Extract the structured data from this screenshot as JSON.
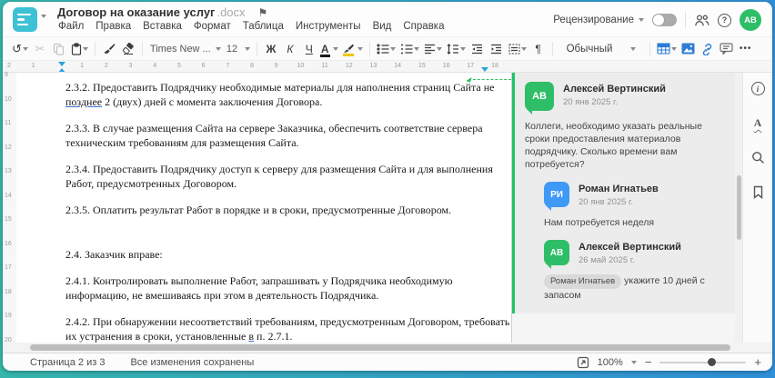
{
  "header": {
    "title": "Договор на оказание услуг",
    "title_ext": ".docx",
    "menu": [
      "Файл",
      "Правка",
      "Вставка",
      "Формат",
      "Таблица",
      "Инструменты",
      "Вид",
      "Справка"
    ],
    "review_label": "Рецензирование",
    "help_glyph": "?",
    "avatar_initials": "АВ"
  },
  "toolbar": {
    "undo_glyph": "↺",
    "cut_glyph": "✂",
    "font_name": "Times New ...",
    "font_size": "12",
    "bold_label": "Ж",
    "italic_label": "К",
    "underline_label": "Ч",
    "font_color_label": "A",
    "pilcrow": "¶",
    "style_name": "Обычный",
    "more_glyph": "•••"
  },
  "ruler": {
    "h_left_labels": [
      "2",
      "1"
    ],
    "h_main_from": 1,
    "h_main_to": 18,
    "v_from": 9,
    "v_to": 20
  },
  "document": {
    "paragraphs": [
      {
        "lines": [
          [
            "2.3.2. Предоставить Подрядчику необходимые материалы для наполнения страниц Сайта не"
          ],
          [
            {
              "t": "позднее",
              "u": true
            },
            {
              "t": " 2 (двух) дней с момента заключения Договора."
            }
          ]
        ]
      },
      {
        "lines": [
          [
            "2.3.3. В случае размещения Сайта на сервере Заказчика, обеспечить соответствие сервера"
          ],
          [
            "техническим требованиям для размещения Сайта."
          ]
        ]
      },
      {
        "lines": [
          [
            "2.3.4. Предоставить Подрядчику доступ к серверу для размещения Сайта и для выполнения"
          ],
          [
            "Работ, предусмотренных Договором."
          ]
        ]
      },
      {
        "lines": [
          [
            "2.3.5. Оплатить результат Работ в порядке и в сроки, предусмотренные Договором."
          ]
        ]
      },
      {
        "extra_space": true,
        "lines": [
          [
            "2.4. Заказчик вправе:"
          ]
        ]
      },
      {
        "lines": [
          [
            "2.4.1. Контролировать выполнение Работ, запрашивать у Подрядчика необходимую"
          ],
          [
            "информацию, не вмешиваясь при этом в деятельность Подрядчика."
          ]
        ]
      },
      {
        "lines": [
          [
            "2.4.2. При обнаружении несоответствий требованиям, предусмотренным Договором, требовать"
          ],
          [
            {
              "t": "их устранения в сроки, установленные "
            },
            {
              "t": "в",
              "u": true
            },
            {
              "t": " п. 2.7.1."
            }
          ]
        ]
      }
    ]
  },
  "comments": {
    "threads": [
      {
        "comments": [
          {
            "initials": "АВ",
            "color": "#2fbe68",
            "name": "Алексей Вертинский",
            "date": "20 янв 2025 г.",
            "text": "Коллеги, необходимо указать реальные сроки предоставления материалов подрядчику. Сколько времени вам потребуется?",
            "reply": false
          },
          {
            "initials": "РИ",
            "color": "#3f9af7",
            "name": "Роман Игнатьев",
            "date": "20 янв 2025 г.",
            "text": "Нам потребуется неделя",
            "reply": true
          },
          {
            "initials": "АВ",
            "color": "#2fbe68",
            "name": "Алексей Вертинский",
            "date": "26 май 2025 г.",
            "mention": "Роман Игнатьев",
            "text": "укажите 10 дней с запасом",
            "reply": true
          }
        ]
      }
    ]
  },
  "statusbar": {
    "page": "Страница 2 из 3",
    "saved": "Все изменения сохранены",
    "zoom": "100%"
  },
  "colors": {
    "accent_blue": "#2e7cd6",
    "logo_teal": "#3ec1d5",
    "avatar_green": "#2fbe68",
    "avatar_blue": "#3f9af7",
    "comment_green": "#22c268",
    "ruler_marker_blue": "#2aa2e0",
    "highlight_yellow": "#f2c500"
  }
}
